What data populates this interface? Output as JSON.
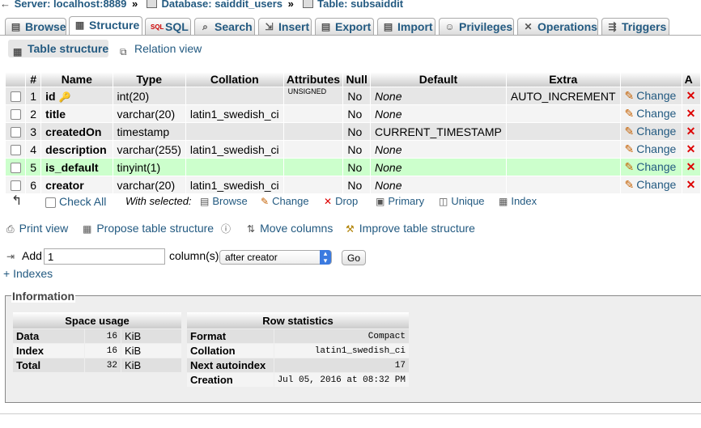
{
  "breadcrumb": {
    "server": "Server: localhost:8889",
    "database": "Database: saiddit_users",
    "table": "Table: subsaiddit",
    "separator": "»"
  },
  "tabs": [
    {
      "label": "Browse",
      "icon": "browse-icon"
    },
    {
      "label": "Structure",
      "icon": "structure-icon",
      "active": true
    },
    {
      "label": "SQL",
      "icon": "sql-icon"
    },
    {
      "label": "Search",
      "icon": "search-icon"
    },
    {
      "label": "Insert",
      "icon": "insert-icon"
    },
    {
      "label": "Export",
      "icon": "export-icon"
    },
    {
      "label": "Import",
      "icon": "import-icon"
    },
    {
      "label": "Privileges",
      "icon": "privileges-icon"
    },
    {
      "label": "Operations",
      "icon": "operations-icon"
    },
    {
      "label": "Triggers",
      "icon": "triggers-icon"
    }
  ],
  "subnav": [
    {
      "label": "Table structure",
      "active": true
    },
    {
      "label": "Relation view"
    }
  ],
  "columns_header": [
    "#",
    "Name",
    "Type",
    "Collation",
    "Attributes",
    "Null",
    "Default",
    "Extra",
    "A"
  ],
  "rows": [
    {
      "num": "1",
      "name": "id",
      "type": "int(20)",
      "collation": "",
      "attributes": "UNSIGNED",
      "null": "No",
      "default": "None",
      "extra": "AUTO_INCREMENT",
      "action": "Change",
      "key_icon": "primary-key-icon"
    },
    {
      "num": "2",
      "name": "title",
      "type": "varchar(20)",
      "collation": "latin1_swedish_ci",
      "attributes": "",
      "null": "No",
      "default": "None",
      "extra": "",
      "action": "Change"
    },
    {
      "num": "3",
      "name": "createdOn",
      "type": "timestamp",
      "collation": "",
      "attributes": "",
      "null": "No",
      "default": "CURRENT_TIMESTAMP",
      "extra": "",
      "action": "Change"
    },
    {
      "num": "4",
      "name": "description",
      "type": "varchar(255)",
      "collation": "latin1_swedish_ci",
      "attributes": "",
      "null": "No",
      "default": "None",
      "extra": "",
      "action": "Change"
    },
    {
      "num": "5",
      "name": "is_default",
      "type": "tinyint(1)",
      "collation": "",
      "attributes": "",
      "null": "No",
      "default": "None",
      "extra": "",
      "action": "Change",
      "highlighted": true
    },
    {
      "num": "6",
      "name": "creator",
      "type": "varchar(20)",
      "collation": "latin1_swedish_ci",
      "attributes": "",
      "null": "No",
      "default": "None",
      "extra": "",
      "action": "Change"
    }
  ],
  "with_selected": {
    "check_all": "Check All",
    "label": "With selected:",
    "actions": [
      "Browse",
      "Change",
      "Drop",
      "Primary",
      "Unique",
      "Index"
    ]
  },
  "page_actions": [
    "Print view",
    "Propose table structure",
    "Move columns",
    "Improve table structure"
  ],
  "add": {
    "label": "Add",
    "value": "1",
    "columns_label": "column(s)",
    "position": "after creator",
    "go": "Go",
    "indexes_link": "+ Indexes"
  },
  "information": {
    "legend": "Information",
    "space_usage": {
      "title": "Space usage",
      "rows": [
        {
          "label": "Data",
          "value": "16",
          "unit": "KiB"
        },
        {
          "label": "Index",
          "value": "16",
          "unit": "KiB"
        },
        {
          "label": "Total",
          "value": "32",
          "unit": "KiB"
        }
      ]
    },
    "row_statistics": {
      "title": "Row statistics",
      "rows": [
        {
          "label": "Format",
          "value": "Compact"
        },
        {
          "label": "Collation",
          "value": "latin1_swedish_ci"
        },
        {
          "label": "Next autoindex",
          "value": "17"
        },
        {
          "label": "Creation",
          "value": "Jul 05, 2016 at 08:32 PM"
        }
      ]
    }
  },
  "colors": {
    "link": "#235a81",
    "highlight_row": "#ccffcc",
    "drop": "#dd0000"
  }
}
